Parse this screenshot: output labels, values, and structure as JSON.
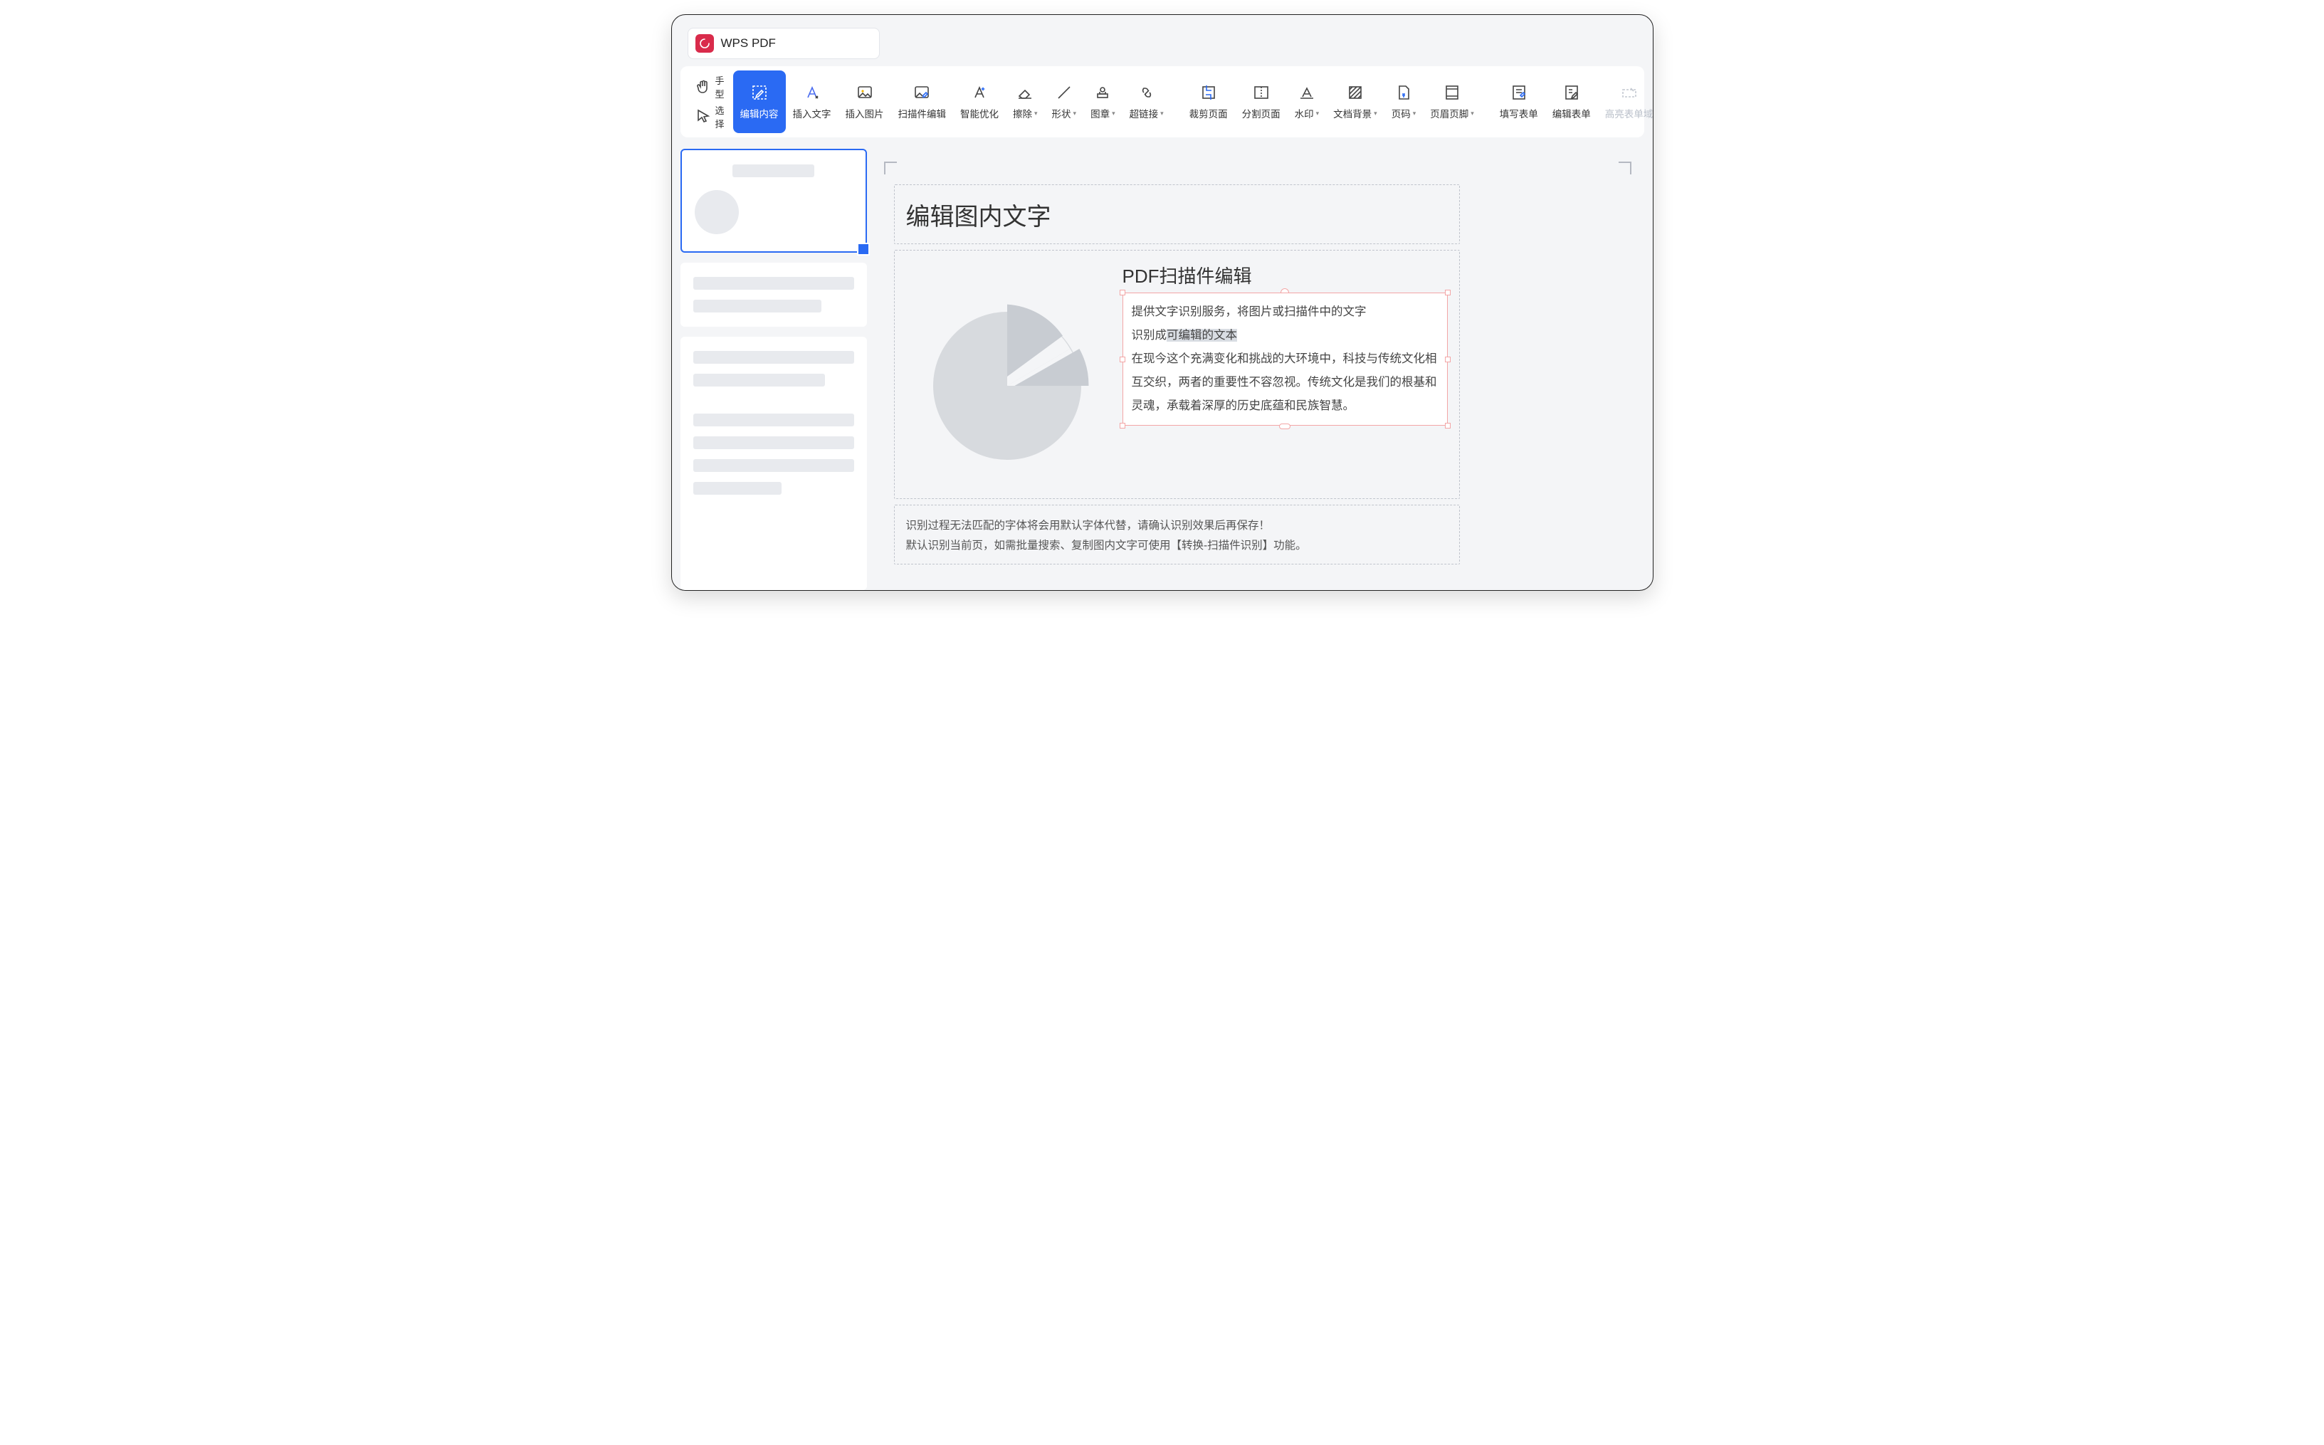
{
  "app": {
    "title": "WPS PDF"
  },
  "toolbar": {
    "mode": {
      "hand": "手型",
      "select": "选择"
    },
    "edit_content": "编辑内容",
    "insert_text": "插入文字",
    "insert_image": "插入图片",
    "scan_edit": "扫描件编辑",
    "smart_optimize": "智能优化",
    "erase": "擦除",
    "shape": "形状",
    "stamp": "图章",
    "hyperlink": "超链接",
    "crop_page": "裁剪页面",
    "split_page": "分割页面",
    "watermark": "水印",
    "background": "文档背景",
    "page_number": "页码",
    "header_footer": "页眉页脚",
    "fill_form": "填写表单",
    "edit_form": "编辑表单",
    "highlight_form": "高亮表单域"
  },
  "page": {
    "main_title": "编辑图内文字",
    "sub_heading": "PDF扫描件编辑",
    "para1_line1": "提供文字识别服务，将图片或扫描件中的文字",
    "para1_line2_pre": "识别成",
    "para1_line2_hl": "可编辑的文本",
    "para2": "在现今这个充满变化和挑战的大环境中，科技与传统文化相互交织，两者的重要性不容忽视。传统文化是我们的根基和灵魂，承载着深厚的历史底蕴和民族智慧。",
    "footer1": "识别过程无法匹配的字体将会用默认字体代替，请确认识别效果后再保存！",
    "footer2": "默认识别当前页，如需批量搜索、复制图内文字可使用【转换-扫描件识别】功能。"
  }
}
